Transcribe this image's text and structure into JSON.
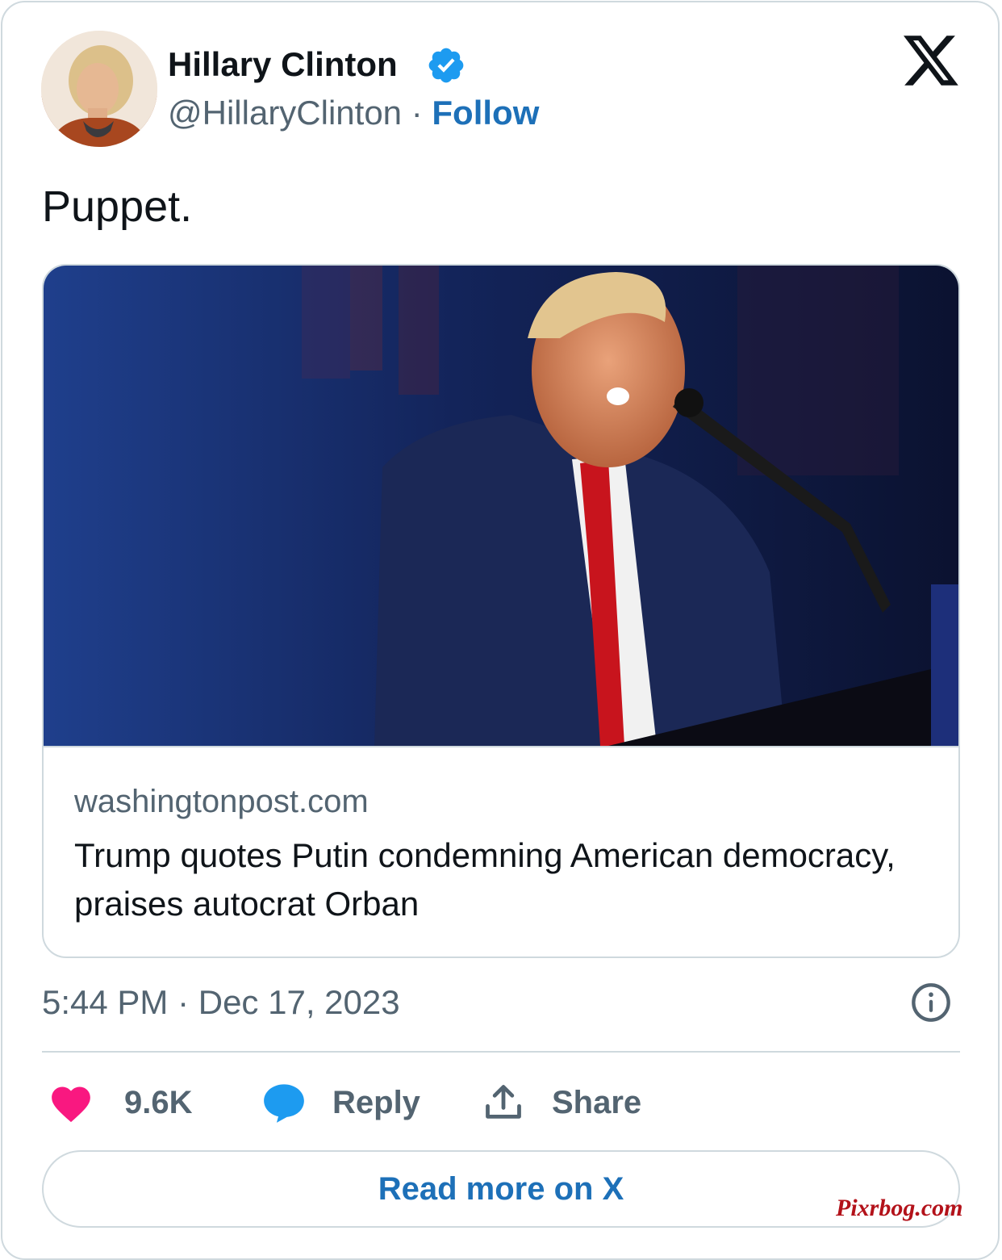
{
  "author": {
    "name": "Hillary Clinton",
    "handle": "@HillaryClinton",
    "separator": "·",
    "follow_label": "Follow",
    "verified": true
  },
  "platform_icon": "x-logo-icon",
  "tweet": {
    "text": "Puppet."
  },
  "link_card": {
    "domain": "washingtonpost.com",
    "headline": "Trump quotes Putin condemning American democracy, praises autocrat Orban",
    "image_icon": "photo-speaker-at-podium"
  },
  "meta": {
    "timestamp": "5:44 PM · Dec 17, 2023",
    "info_icon": "info-icon"
  },
  "actions": {
    "likes_count": "9.6K",
    "reply_label": "Reply",
    "share_label": "Share"
  },
  "read_more_label": "Read more on X",
  "watermark": "Pixrbog.com",
  "colors": {
    "accent": "#1d70b8",
    "verified": "#1d9bf0",
    "like": "#f91880",
    "muted": "#536471",
    "border": "#cfd9de"
  }
}
